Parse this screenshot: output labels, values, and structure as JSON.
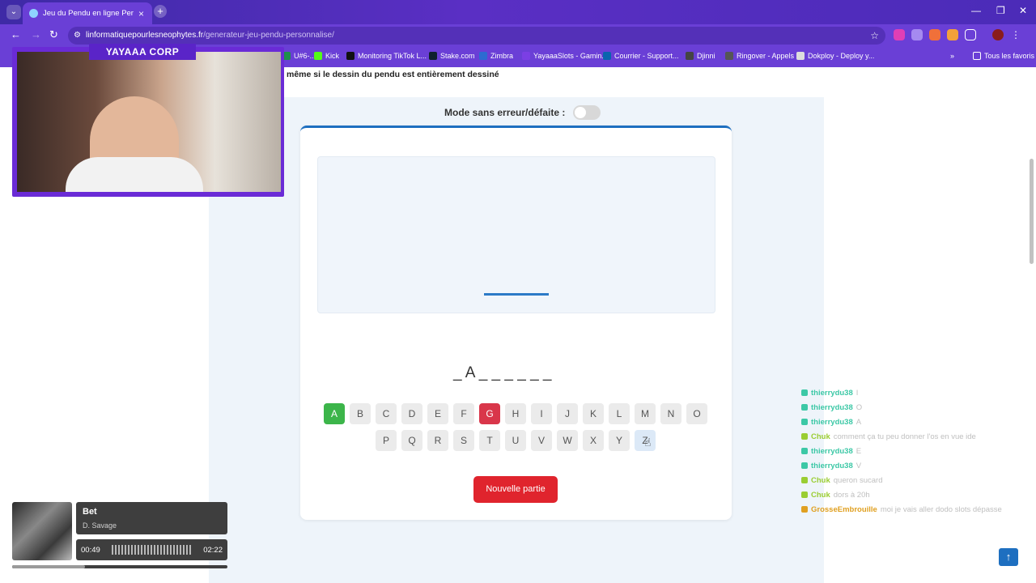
{
  "browser": {
    "tab_title": "Jeu du Pendu en ligne Personnalisé",
    "url_host": "linformatiquepourlesneophytes.fr",
    "url_path": "/generateur-jeu-pendu-personnalise/",
    "bookmarks": [
      {
        "label": "U#6-...",
        "color": "#1f8f4b"
      },
      {
        "label": "Kick",
        "color": "#53fc18"
      },
      {
        "label": "Monitoring TikTok L...",
        "color": "#111111"
      },
      {
        "label": "Stake.com",
        "color": "#0f212e"
      },
      {
        "label": "Zimbra",
        "color": "#2d6bd1"
      },
      {
        "label": "YayaaaSlots - Gamin...",
        "color": "#7b3fe4"
      },
      {
        "label": "Courrier - Support...",
        "color": "#0a64ad"
      },
      {
        "label": "Djinni",
        "color": "#444444"
      },
      {
        "label": "Ringover - Appels",
        "color": "#555555"
      },
      {
        "label": "Dokploy - Deploy y...",
        "color": "#dddddd"
      }
    ],
    "all_bookmarks": "Tous les favoris"
  },
  "page": {
    "intro_text": "même si le dessin du pendu est entièrement dessiné",
    "mode_label": "Mode sans erreur/défaite :",
    "word_display": "_ A _ _ _ _ _ _",
    "keyboard_row1": [
      {
        "letter": "A",
        "state": "correct"
      },
      {
        "letter": "B",
        "state": "none"
      },
      {
        "letter": "C",
        "state": "none"
      },
      {
        "letter": "D",
        "state": "none"
      },
      {
        "letter": "E",
        "state": "none"
      },
      {
        "letter": "F",
        "state": "none"
      },
      {
        "letter": "G",
        "state": "wrong"
      },
      {
        "letter": "H",
        "state": "none"
      },
      {
        "letter": "I",
        "state": "none"
      },
      {
        "letter": "J",
        "state": "none"
      },
      {
        "letter": "K",
        "state": "none"
      },
      {
        "letter": "L",
        "state": "none"
      },
      {
        "letter": "M",
        "state": "none"
      },
      {
        "letter": "N",
        "state": "none"
      },
      {
        "letter": "O",
        "state": "none"
      }
    ],
    "keyboard_row2": [
      {
        "letter": "P",
        "state": "none"
      },
      {
        "letter": "Q",
        "state": "none"
      },
      {
        "letter": "R",
        "state": "none"
      },
      {
        "letter": "S",
        "state": "none"
      },
      {
        "letter": "T",
        "state": "none"
      },
      {
        "letter": "U",
        "state": "none"
      },
      {
        "letter": "V",
        "state": "none"
      },
      {
        "letter": "W",
        "state": "none"
      },
      {
        "letter": "X",
        "state": "none"
      },
      {
        "letter": "Y",
        "state": "none"
      },
      {
        "letter": "Z",
        "state": "hover"
      }
    ],
    "new_game_label": "Nouvelle partie"
  },
  "webcam": {
    "label": "YAYAAA CORP"
  },
  "chat": [
    {
      "user": "thierrydu38",
      "color": "#3cc8a6",
      "message": "I"
    },
    {
      "user": "thierrydu38",
      "color": "#3cc8a6",
      "message": "O"
    },
    {
      "user": "thierrydu38",
      "color": "#3cc8a6",
      "message": "A"
    },
    {
      "user": "Chuk",
      "color": "#9acd32",
      "message": "comment ça tu peu donner l'os en vue ide"
    },
    {
      "user": "thierrydu38",
      "color": "#3cc8a6",
      "message": "E"
    },
    {
      "user": "thierrydu38",
      "color": "#3cc8a6",
      "message": "V"
    },
    {
      "user": "Chuk",
      "color": "#9acd32",
      "message": "queron sucard"
    },
    {
      "user": "Chuk",
      "color": "#9acd32",
      "message": "dors à 20h"
    },
    {
      "user": "GrosseEmbrouille",
      "color": "#e0a021",
      "message": "moi je vais aller dodo slots dépasse"
    }
  ],
  "music": {
    "title": "Bet",
    "artist": "D. Savage",
    "elapsed": "00:49",
    "total": "02:22",
    "progress": 0.34
  },
  "colors": {
    "accent": "#1e6fc0",
    "correct": "#3cb54a",
    "wrong": "#d9364a",
    "new_game": "#e0242d",
    "browser_purple": "#6a3fd6"
  }
}
